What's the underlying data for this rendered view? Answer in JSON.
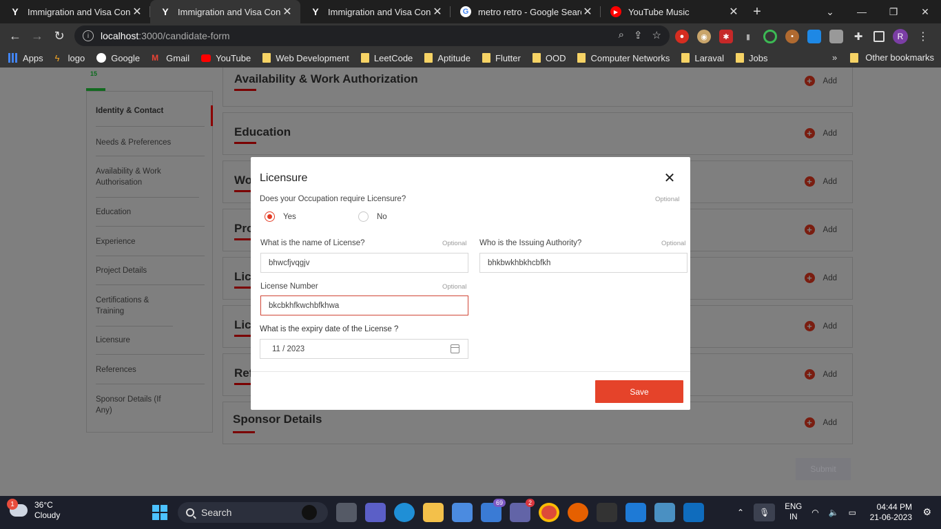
{
  "browser": {
    "tabs": [
      {
        "title": "Immigration and Visa Consul",
        "icon": "y-icon",
        "active": false
      },
      {
        "title": "Immigration and Visa Consul",
        "icon": "y-icon",
        "active": true
      },
      {
        "title": "Immigration and Visa Consul",
        "icon": "y-icon",
        "active": false
      },
      {
        "title": "metro retro - Google Search",
        "icon": "google-icon",
        "active": false
      },
      {
        "title": "YouTube Music",
        "icon": "youtube-music-icon",
        "active": false
      }
    ],
    "url_host": "localhost",
    "url_path": ":3000/candidate-form",
    "bookmarks": [
      "Apps",
      "logo",
      "Google",
      "Gmail",
      "YouTube",
      "Web Development",
      "LeetCode",
      "Aptitude",
      "Flutter",
      "OOD",
      "Computer Networks",
      "Laraval",
      "Jobs"
    ],
    "more_bookmarks": "»",
    "other_bookmarks": "Other bookmarks",
    "profile_initial": "R"
  },
  "page": {
    "progress_value": "15",
    "sidebar": [
      {
        "label": "Identity & Contact",
        "active": true
      },
      {
        "label": "Needs & Preferences"
      },
      {
        "label": "Availability & Work Authorisation"
      },
      {
        "label": "Education"
      },
      {
        "label": "Experience"
      },
      {
        "label": "Project Details"
      },
      {
        "label": "Certifications & Training"
      },
      {
        "label": "Licensure"
      },
      {
        "label": "References"
      },
      {
        "label": "Sponsor Details (If Any)"
      }
    ],
    "sections": [
      {
        "title": "Availability & Work Authorization"
      },
      {
        "title": "Education"
      },
      {
        "title": "Wo"
      },
      {
        "title": "Pro"
      },
      {
        "title": "Lic"
      },
      {
        "title": "Lic"
      },
      {
        "title": "Ref"
      },
      {
        "title": "Sponsor Details"
      }
    ],
    "add_label": "Add",
    "submit_label": "Submit"
  },
  "modal": {
    "title": "Licensure",
    "question": "Does your Occupation require Licensure?",
    "optional": "Optional",
    "yes": "Yes",
    "no": "No",
    "license_name_label": "What is the name of License?",
    "license_name_value": "bhwcfjvqgjv",
    "authority_label": "Who is the Issuing Authority?",
    "authority_value": "bhkbwkhbkhcbfkh",
    "license_number_label": "License Number",
    "license_number_value": "bkcbkhfkwchbfkhwa",
    "expiry_label": "What is the expiry date of the License ?",
    "expiry_value": "11 / 2023",
    "save_label": "Save"
  },
  "taskbar": {
    "weather_badge": "1",
    "temp": "36°C",
    "condition": "Cloudy",
    "search_label": "Search",
    "mail_count": "69",
    "teams_count": "2",
    "lang_line1": "ENG",
    "lang_line2": "IN",
    "time": "04:44 PM",
    "date": "21-06-2023"
  },
  "colors": {
    "accent": "#e5432a",
    "progress": "#126a1f"
  }
}
